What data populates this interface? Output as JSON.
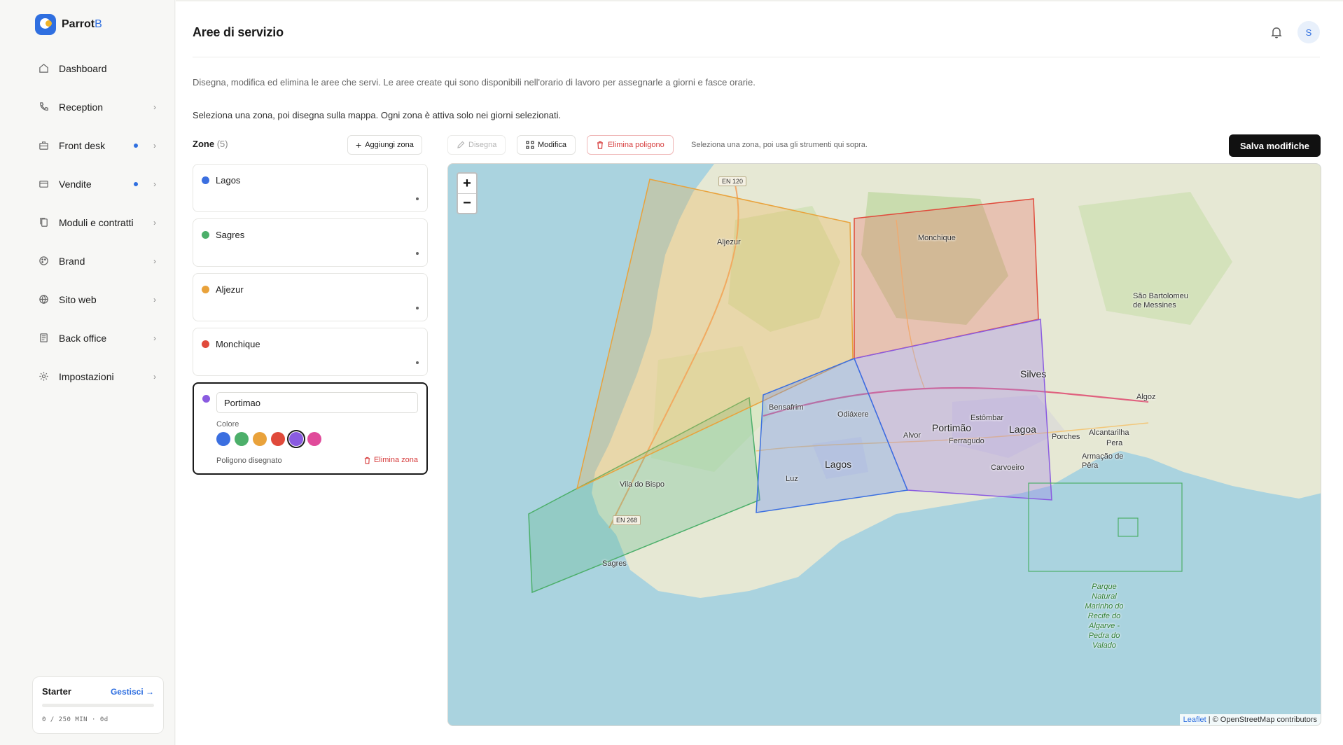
{
  "app": {
    "brand_main": "Parrot",
    "brand_accent": "B"
  },
  "sidebar": {
    "items": [
      {
        "label": "Dashboard",
        "icon": "home-icon",
        "chevron": false,
        "dot": false
      },
      {
        "label": "Reception",
        "icon": "phone-icon",
        "chevron": true,
        "dot": false
      },
      {
        "label": "Front desk",
        "icon": "briefcase-icon",
        "chevron": true,
        "dot": true
      },
      {
        "label": "Vendite",
        "icon": "credit-card-icon",
        "chevron": true,
        "dot": true
      },
      {
        "label": "Moduli e contratti",
        "icon": "copy-icon",
        "chevron": true,
        "dot": false
      },
      {
        "label": "Brand",
        "icon": "palette-icon",
        "chevron": true,
        "dot": false
      },
      {
        "label": "Sito web",
        "icon": "globe-icon",
        "chevron": true,
        "dot": false
      },
      {
        "label": "Back office",
        "icon": "file-icon",
        "chevron": true,
        "dot": false
      },
      {
        "label": "Impostazioni",
        "icon": "gear-icon",
        "chevron": true,
        "dot": false
      }
    ],
    "plan": {
      "name": "Starter",
      "manage": "Gestisci →",
      "usage": "0 / 250 MIN · 0d",
      "usage_fraction": 0
    }
  },
  "header": {
    "title": "Aree di servizio",
    "avatar_initial": "S"
  },
  "intro": {
    "description": "Disegna, modifica ed elimina le aree che servi. Le aree create qui sono disponibili nell'orario di lavoro per assegnarle a giorni e fasce orarie.",
    "instruction": "Seleziona una zona, poi disegna sulla mappa. Ogni zona è attiva solo nei giorni selezionati."
  },
  "zones": {
    "heading": "Zone",
    "count": "(5)",
    "add_label": "Aggiungi zona",
    "items": [
      {
        "name": "Lagos",
        "color": "#3b6fe0"
      },
      {
        "name": "Sagres",
        "color": "#4caf6a"
      },
      {
        "name": "Aljezur",
        "color": "#e9a23b"
      },
      {
        "name": "Monchique",
        "color": "#e04a3b"
      }
    ],
    "active": {
      "name": "Portimao",
      "color": "#8a5be0",
      "color_label": "Colore",
      "palette": [
        "#3b6fe0",
        "#4caf6a",
        "#e9a23b",
        "#e04a3b",
        "#8a5be0",
        "#e04a9a"
      ],
      "selected_index": 4,
      "status": "Poligono disegnato",
      "delete_label": "Elimina zona"
    }
  },
  "toolbar": {
    "draw": "Disegna",
    "edit": "Modifica",
    "delete_polygon": "Elimina poligono",
    "hint": "Seleziona una zona, poi usa gli strumenti qui sopra.",
    "save": "Salva modifiche"
  },
  "map": {
    "zoom_in": "+",
    "zoom_out": "−",
    "attribution_leaflet": "Leaflet",
    "attribution_osm": " | © OpenStreetMap contributors",
    "road_shields": [
      "EN 120",
      "EN 268"
    ],
    "labels": [
      "Aljezur",
      "Monchique",
      "Silves",
      "Bensafrim",
      "Odiáxere",
      "Portimão",
      "Lagoa",
      "Estômbar",
      "Alvor",
      "Ferragudo",
      "Lagos",
      "Luz",
      "Vila do Bispo",
      "Sagres",
      "Carvoeiro",
      "Porches",
      "Algoz",
      "Alcantarilha",
      "Pera",
      "Armação de Pêra",
      "São Bartolomeu de Messines"
    ],
    "park_label": "Parque Natural Marinho do Recife do Algarve - Pedra do Valado"
  }
}
